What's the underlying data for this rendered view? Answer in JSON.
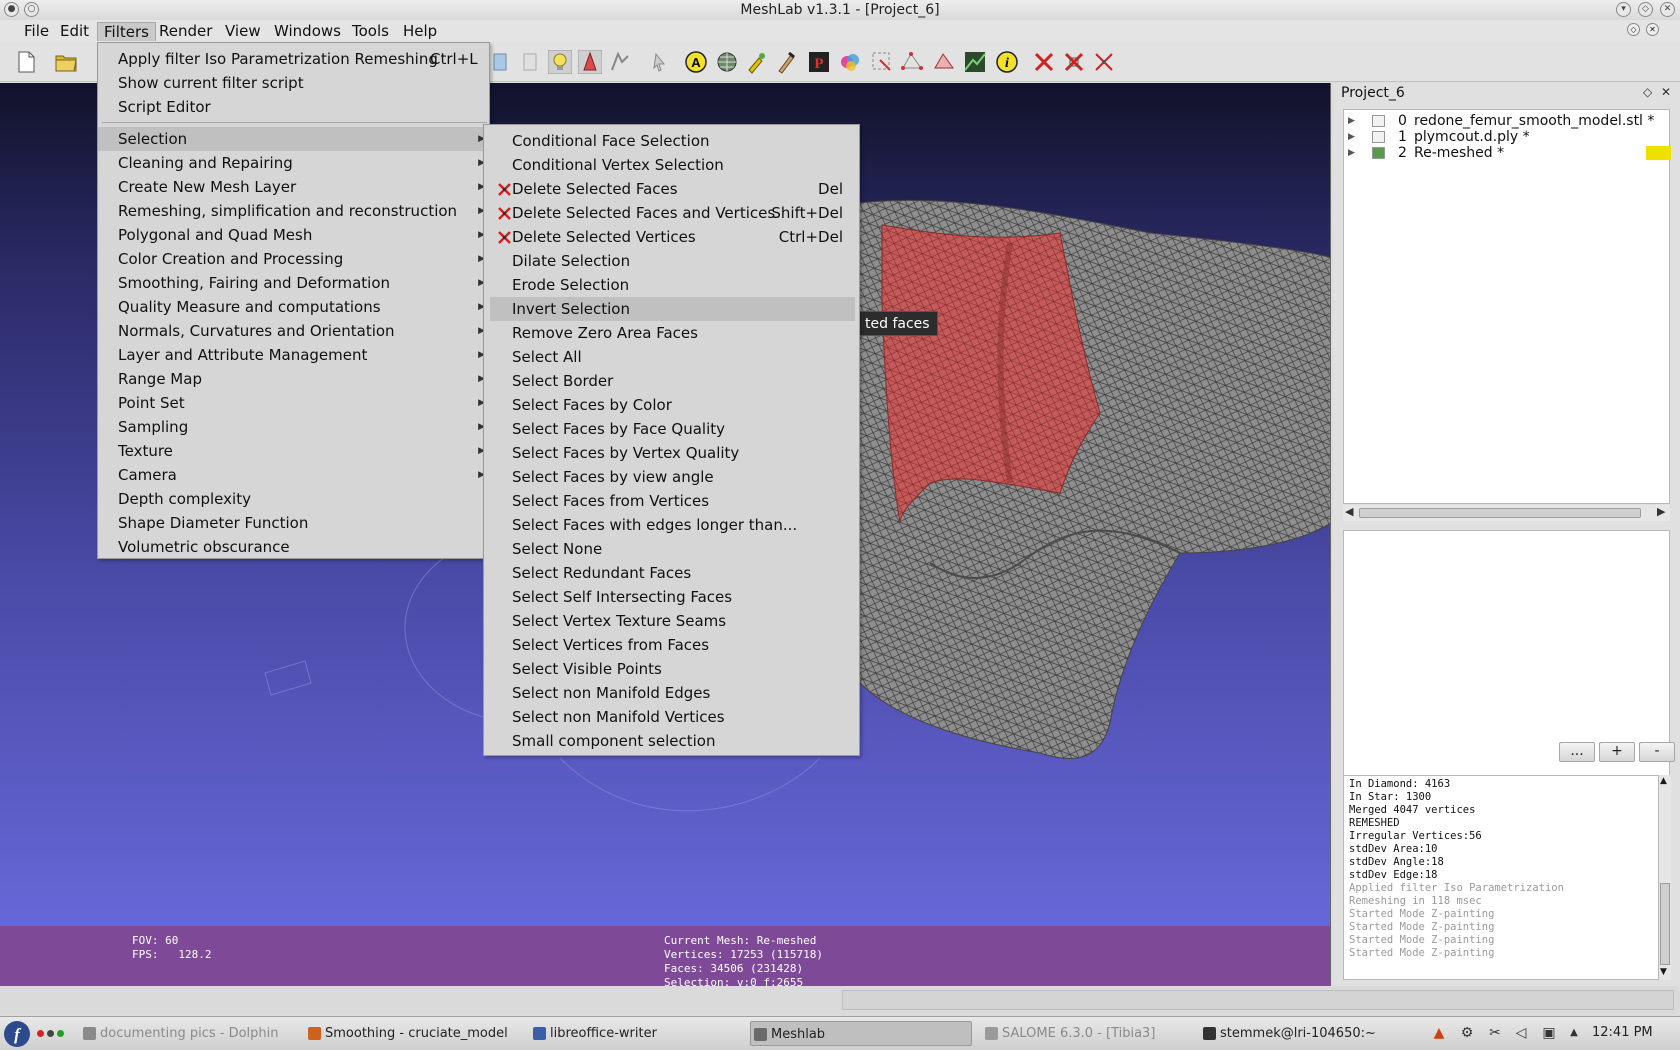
{
  "window": {
    "title": "MeshLab v1.3.1 - [Project_6]"
  },
  "menubar": {
    "items": [
      "File",
      "Edit",
      "Filters",
      "Render",
      "View",
      "Windows",
      "Tools",
      "Help"
    ]
  },
  "filters_menu": {
    "top_items": [
      {
        "label": "Apply filter Iso Parametrization Remeshing",
        "shortcut": "Ctrl+L"
      },
      {
        "label": "Show current filter script",
        "shortcut": ""
      },
      {
        "label": "Script Editor",
        "shortcut": ""
      }
    ],
    "categories": [
      "Selection",
      "Cleaning and Repairing",
      "Create New Mesh Layer",
      "Remeshing, simplification and reconstruction",
      "Polygonal and Quad Mesh",
      "Color Creation and Processing",
      "Smoothing, Fairing and Deformation",
      "Quality Measure and computations",
      "Normals, Curvatures and Orientation",
      "Layer and Attribute Management",
      "Range Map",
      "Point Set",
      "Sampling",
      "Texture",
      "Camera"
    ],
    "bottom_items": [
      "Depth complexity",
      "Shape Diameter Function",
      "Volumetric obscurance"
    ]
  },
  "selection_menu": {
    "items": [
      {
        "label": "Conditional Face Selection",
        "shortcut": "",
        "icon": ""
      },
      {
        "label": "Conditional Vertex Selection",
        "shortcut": "",
        "icon": ""
      },
      {
        "label": "Delete Selected Faces",
        "shortcut": "Del",
        "icon": "delete-faces-icon"
      },
      {
        "label": "Delete Selected Faces and Vertices",
        "shortcut": "Shift+Del",
        "icon": "delete-faces-vertices-icon"
      },
      {
        "label": "Delete Selected Vertices",
        "shortcut": "Ctrl+Del",
        "icon": "delete-vertices-icon"
      },
      {
        "label": "Dilate Selection",
        "shortcut": "",
        "icon": ""
      },
      {
        "label": "Erode Selection",
        "shortcut": "",
        "icon": ""
      },
      {
        "label": "Invert Selection",
        "shortcut": "",
        "icon": ""
      },
      {
        "label": "Remove Zero Area Faces",
        "shortcut": "",
        "icon": ""
      },
      {
        "label": "Select All",
        "shortcut": "",
        "icon": ""
      },
      {
        "label": "Select Border",
        "shortcut": "",
        "icon": ""
      },
      {
        "label": "Select Faces by Color",
        "shortcut": "",
        "icon": ""
      },
      {
        "label": "Select Faces by Face Quality",
        "shortcut": "",
        "icon": ""
      },
      {
        "label": "Select Faces by Vertex Quality",
        "shortcut": "",
        "icon": ""
      },
      {
        "label": "Select Faces by view angle",
        "shortcut": "",
        "icon": ""
      },
      {
        "label": "Select Faces from Vertices",
        "shortcut": "",
        "icon": ""
      },
      {
        "label": "Select Faces with edges longer than...",
        "shortcut": "",
        "icon": ""
      },
      {
        "label": "Select None",
        "shortcut": "",
        "icon": ""
      },
      {
        "label": "Select Redundant Faces",
        "shortcut": "",
        "icon": ""
      },
      {
        "label": "Select Self Intersecting Faces",
        "shortcut": "",
        "icon": ""
      },
      {
        "label": "Select Vertex Texture Seams",
        "shortcut": "",
        "icon": ""
      },
      {
        "label": "Select Vertices from Faces",
        "shortcut": "",
        "icon": ""
      },
      {
        "label": "Select Visible Points",
        "shortcut": "",
        "icon": ""
      },
      {
        "label": "Select non Manifold Edges",
        "shortcut": "",
        "icon": ""
      },
      {
        "label": "Select non Manifold Vertices",
        "shortcut": "",
        "icon": ""
      },
      {
        "label": "Small component selection",
        "shortcut": "",
        "icon": ""
      }
    ],
    "highlighted": "Invert Selection"
  },
  "tooltip": {
    "text": "ted faces"
  },
  "viewport_info": {
    "fov": "FOV: 60",
    "fps": "FPS:   128.2",
    "current_mesh": "Current Mesh: Re-meshed",
    "vertices": "Vertices: 17253 (115718)",
    "faces": "Faces: 34506 (231428)",
    "selection": "Selection: v:0 f:2655"
  },
  "project_panel": {
    "title": "Project_6",
    "layers": [
      {
        "num": "0",
        "name": "redone_femur_smooth_model.stl *",
        "visible": false
      },
      {
        "num": "1",
        "name": "plymcout.d.ply *",
        "visible": false
      },
      {
        "num": "2",
        "name": "Re-meshed *",
        "visible": true
      }
    ],
    "buttons": [
      "...",
      "+",
      "-"
    ],
    "log": [
      {
        "text": "In Diamond: 4163",
        "dim": false
      },
      {
        "text": "In Star: 1300",
        "dim": false
      },
      {
        "text": "Merged 4047 vertices",
        "dim": false
      },
      {
        "text": "REMESHED",
        "dim": false
      },
      {
        "text": "Irregular Vertices:56",
        "dim": false
      },
      {
        "text": "stdDev Area:10",
        "dim": false
      },
      {
        "text": "stdDev Angle:18",
        "dim": false
      },
      {
        "text": "stdDev Edge:18",
        "dim": false
      },
      {
        "text": "Applied filter Iso Parametrization",
        "dim": true
      },
      {
        "text": "Remeshing in 118 msec",
        "dim": true
      },
      {
        "text": "Started Mode Z-painting",
        "dim": true
      },
      {
        "text": "Started Mode Z-painting",
        "dim": true
      },
      {
        "text": "Started Mode Z-painting",
        "dim": true
      },
      {
        "text": "Started Mode Z-painting",
        "dim": true
      }
    ]
  },
  "taskbar": {
    "tasks": [
      {
        "label": "documenting pics - Dolphin",
        "dim": true,
        "active": false,
        "color": "#8a8a8a"
      },
      {
        "label": "Smoothing - cruciate_model",
        "dim": false,
        "active": false,
        "color": "#d0611c"
      },
      {
        "label": "libreoffice-writer",
        "dim": false,
        "active": false,
        "color": "#3a5ea8"
      },
      {
        "label": "Meshlab",
        "dim": false,
        "active": true,
        "color": "#6a6a6a"
      },
      {
        "label": "SALOME 6.3.0 - [Tibia3]",
        "dim": true,
        "active": false,
        "color": "#9a9a9a"
      },
      {
        "label": "stemmek@lri-104650:~",
        "dim": false,
        "active": false,
        "color": "#333333"
      }
    ],
    "clock": "12:41 PM"
  },
  "colors": {
    "accent": "#7e4a98",
    "selection_red": "#c85050",
    "highlight_yellow": "#f0e000"
  }
}
